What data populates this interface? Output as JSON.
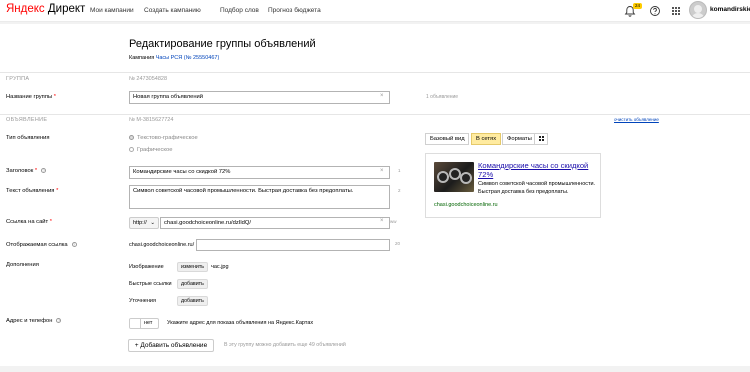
{
  "header": {
    "logo_yandex": "Яндекс",
    "logo_product": "Директ",
    "nav": [
      "Мои кампании",
      "Создать кампанию",
      "Подбор слов",
      "Прогноз бюджета"
    ],
    "notification_count": "24",
    "username": "komandirskie"
  },
  "page": {
    "title": "Редактирование группы объявлений",
    "campaign_prefix": "Кампания",
    "campaign_link": "Часы РСЯ (№ 25550467)"
  },
  "group": {
    "section_label": "ГРУППА",
    "id": "№ 2473054828",
    "name_label": "Название группы",
    "name_value": "Новая группа объявлений",
    "count_note": "1 объявление"
  },
  "ad": {
    "section_label": "ОБЪЯВЛЕНИЕ",
    "id": "№ М-3815627724",
    "clear_link": "очистить объявление",
    "type_label": "Тип объявления",
    "type_options": [
      "Текстово-графическое",
      "Графическое"
    ],
    "headline_label": "Заголовок",
    "headline_value": "Командирские часы со скидкой 72%",
    "headline_counter": "1",
    "text_label": "Текст объявления",
    "text_value": "Символ советской часовой промышленности. Быстрая доставка без предоплаты.",
    "text_counter": "2",
    "site_label": "Ссылка на сайт",
    "protocol": "http://",
    "site_value": "chasi.goodchoiceonline.ru/dzIldQ/",
    "site_counter": "ww",
    "display_label": "Отображаемая ссылка",
    "display_prefix": "chasi.goodchoiceonline.ru/",
    "display_counter": "20",
    "extras_label": "Дополнения",
    "image_label": "Изображение",
    "image_button": "изменить",
    "image_file": "час.jpg",
    "sitelinks_label": "Быстрые ссылки",
    "sitelinks_button": "добавить",
    "callouts_label": "Уточнения",
    "callouts_button": "добавить",
    "address_label": "Адрес и телефон",
    "address_toggle": "нет",
    "address_hint": "Укажите адрес для показа объявления на Яндекс.Картах",
    "add_button": "+ Добавить объявление",
    "add_hint": "В эту группу можно добавить еще 49 объявлений"
  },
  "preview": {
    "tabs": [
      "Базовый вид",
      "В сетях",
      "Форматы"
    ],
    "title": "Командирские часы со скидкой 72%",
    "text": "Символ советской часовой промышленности. Быстрая доставка без предоплаты.",
    "url": "chasi.goodchoiceonline.ru"
  }
}
